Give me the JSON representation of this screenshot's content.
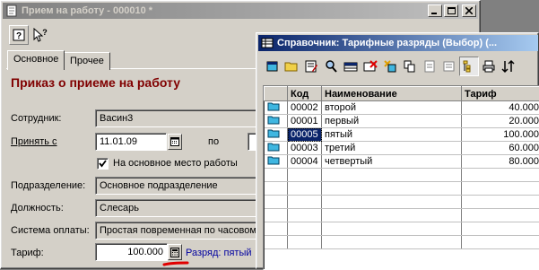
{
  "colors": {
    "order_title": "#800000",
    "link_blue": "#0000a0",
    "selection": "#0a246a",
    "annotation_red": "#e00000",
    "folder_cyan": "#3fb6e0"
  },
  "main_window": {
    "title": "Прием на работу - 000010 *",
    "help_icon": "help-icon",
    "whatsthis_icon": "whats-this-icon",
    "tabs": [
      {
        "label": "Основное",
        "active": true
      },
      {
        "label": "Прочее",
        "active": false
      }
    ],
    "heading": "Приказ о приеме на работу",
    "fields": {
      "employee_label": "Сотрудник:",
      "employee_value": "Васин3",
      "hire_label": "Принять с",
      "hire_value": "11.01.09",
      "to_label": "по",
      "to_value": "",
      "main_job_checkbox": "На основное место работы",
      "main_job_checked": true,
      "department_label": "Подразделение:",
      "department_value": "Основное подразделение",
      "position_label": "Должность:",
      "position_value": "Слесарь",
      "payment_label": "Система оплаты:",
      "payment_value": "Простая повременная по часовом",
      "tariff_label": "Тариф:",
      "tariff_value": "100.000",
      "grade_link": "Разряд: пятый"
    }
  },
  "catalog_window": {
    "title": "Справочник: Тарифные разряды (Выбор) (...",
    "toolbar_icons": [
      "new-icon",
      "open-folder-icon",
      "edit-icon",
      "find-icon",
      "add-row-icon",
      "delete-icon",
      "copy-icon",
      "tree-icon",
      "duplicate-icon",
      "document-icon",
      "print-icon",
      "list-view-icon",
      "sort-icon"
    ],
    "columns": [
      "Код",
      "Наименование",
      "Тариф"
    ],
    "rows": [
      {
        "code": "00002",
        "name": "второй",
        "tariff": "40.000",
        "selected": false
      },
      {
        "code": "00001",
        "name": "первый",
        "tariff": "20.000",
        "selected": false
      },
      {
        "code": "00005",
        "name": "пятый",
        "tariff": "100.000",
        "selected": true
      },
      {
        "code": "00003",
        "name": "третий",
        "tariff": "60.000",
        "selected": false
      },
      {
        "code": "00004",
        "name": "четвертый",
        "tariff": "80.000",
        "selected": false
      }
    ]
  }
}
